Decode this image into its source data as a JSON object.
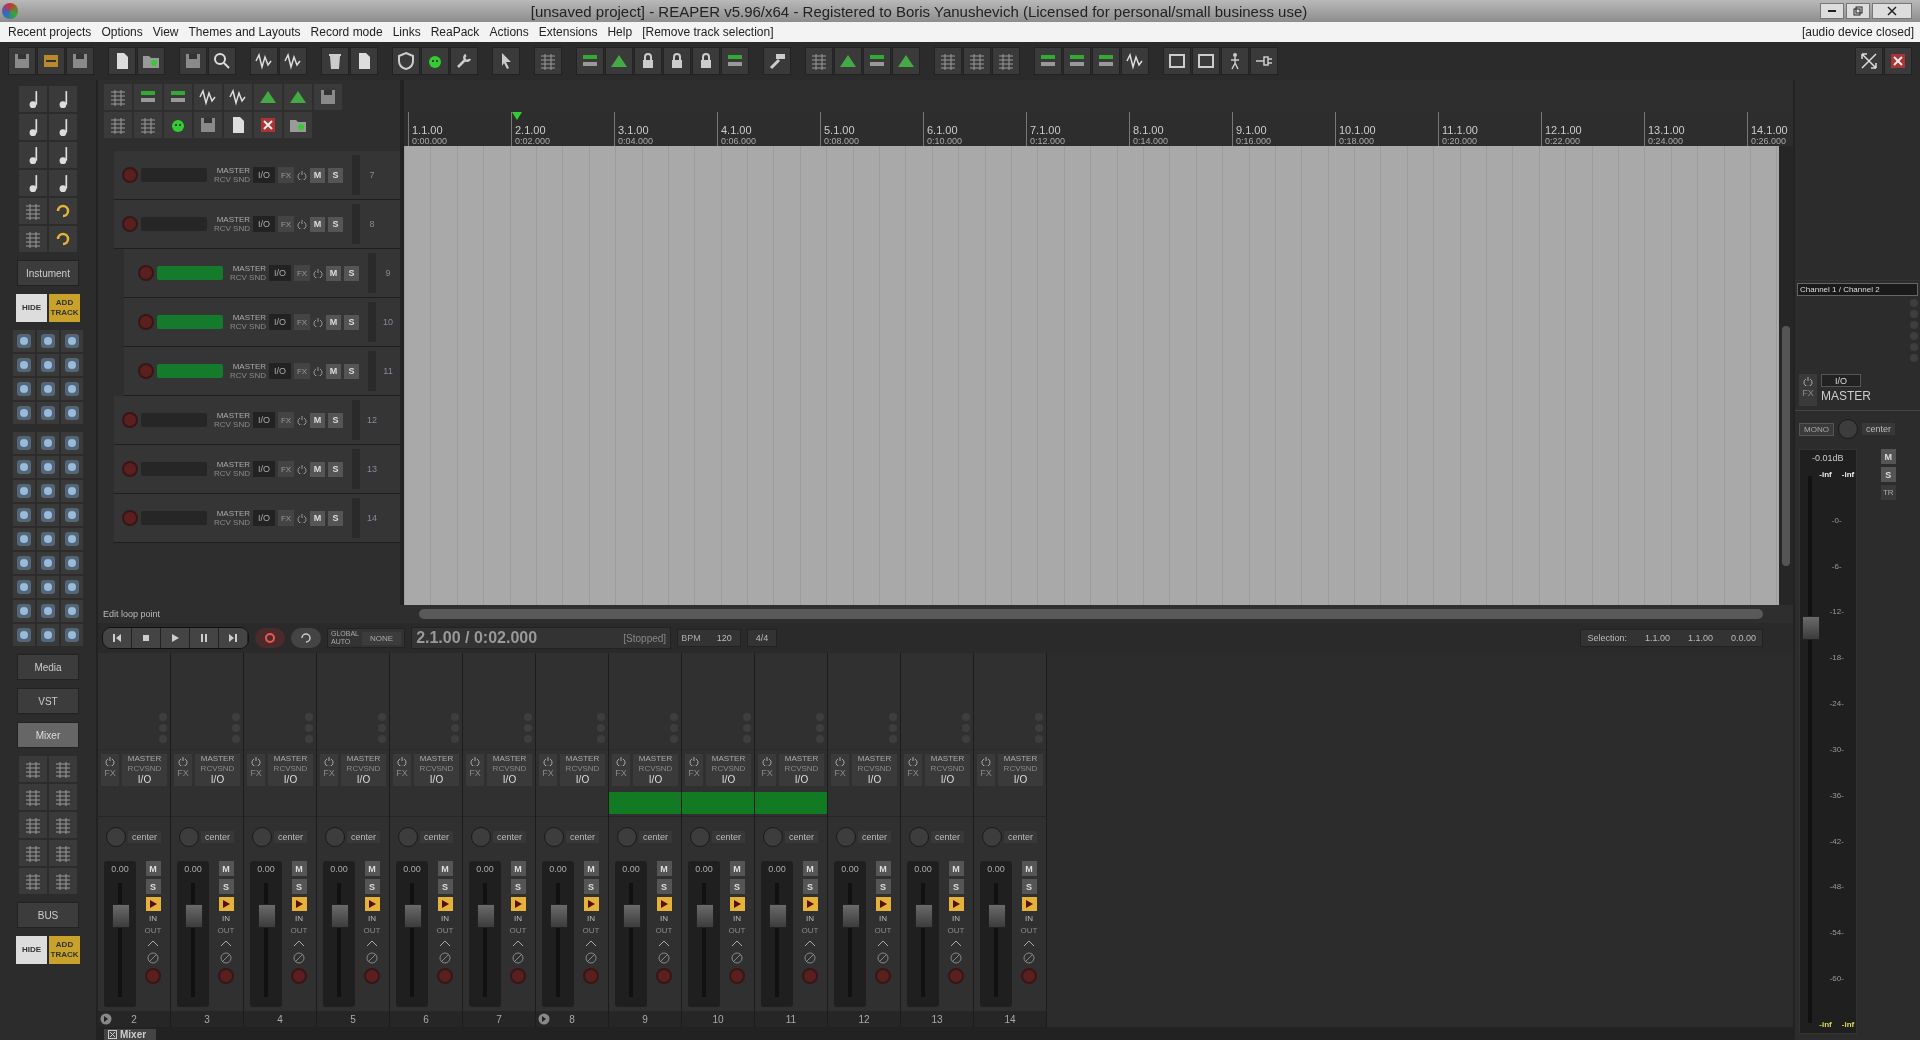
{
  "window": {
    "title": "[unsaved project] - REAPER v5.96/x64 - Registered to Boris Yanushevich (Licensed for personal/small business use)"
  },
  "menu": [
    "Recent projects",
    "Options",
    "View",
    "Themes and Layouts",
    "Record mode",
    "Links",
    "ReaPack",
    "Actions",
    "Extensions",
    "Help",
    "[Remove track selection]"
  ],
  "audio_status": "[audio device closed]",
  "left_panel": {
    "instrument_button": "Instument",
    "track_buttons_top": [
      "HIDE",
      "ADD TRACK"
    ],
    "view_buttons": [
      {
        "label": "Media",
        "selected": false
      },
      {
        "label": "VST",
        "selected": false
      },
      {
        "label": "Mixer",
        "selected": true
      }
    ],
    "bus_button": "BUS",
    "track_buttons_bottom": [
      "HIDE",
      "ADD TRACK"
    ]
  },
  "tracks": [
    {
      "number": "7",
      "selected": false,
      "send": "MASTER",
      "routing": "RCV SND",
      "io": "I/O",
      "fx": "FX",
      "mute": "M",
      "solo": "S"
    },
    {
      "number": "8",
      "selected": false,
      "send": "MASTER",
      "routing": "RCV SND",
      "io": "I/O",
      "fx": "FX",
      "mute": "M",
      "solo": "S",
      "children": [
        {
          "number": "9",
          "selected": true,
          "send": "MASTER",
          "routing": "RCV SND",
          "io": "I/O",
          "fx": "FX",
          "mute": "M",
          "solo": "S"
        },
        {
          "number": "10",
          "selected": true,
          "send": "MASTER",
          "routing": "RCV SND",
          "io": "I/O",
          "fx": "FX",
          "mute": "M",
          "solo": "S"
        },
        {
          "number": "11",
          "selected": true,
          "send": "MASTER",
          "routing": "RCV SND",
          "io": "I/O",
          "fx": "FX",
          "mute": "M",
          "solo": "S"
        }
      ]
    },
    {
      "number": "12",
      "selected": false,
      "send": "MASTER",
      "routing": "RCV SND",
      "io": "I/O",
      "fx": "FX",
      "mute": "M",
      "solo": "S"
    },
    {
      "number": "13",
      "selected": false,
      "send": "MASTER",
      "routing": "RCV SND",
      "io": "I/O",
      "fx": "FX",
      "mute": "M",
      "solo": "S"
    },
    {
      "number": "14",
      "selected": false,
      "send": "MASTER",
      "routing": "RCV SND",
      "io": "I/O",
      "fx": "FX",
      "mute": "M",
      "solo": "S"
    }
  ],
  "ruler": [
    {
      "bar": "1.1.00",
      "time": "0:00.000",
      "playhead": false
    },
    {
      "bar": "2.1.00",
      "time": "0:02.000",
      "playhead": true
    },
    {
      "bar": "3.1.00",
      "time": "0:04.000",
      "playhead": false
    },
    {
      "bar": "4.1.00",
      "time": "0:06.000",
      "playhead": false
    },
    {
      "bar": "5.1.00",
      "time": "0:08.000",
      "playhead": false
    },
    {
      "bar": "6.1.00",
      "time": "0:10.000",
      "playhead": false
    },
    {
      "bar": "7.1.00",
      "time": "0:12.000",
      "playhead": false
    },
    {
      "bar": "8.1.00",
      "time": "0:14.000",
      "playhead": false
    },
    {
      "bar": "9.1.00",
      "time": "0:16.000",
      "playhead": false
    },
    {
      "bar": "10.1.00",
      "time": "0:18.000",
      "playhead": false
    },
    {
      "bar": "11.1.00",
      "time": "0:20.000",
      "playhead": false
    },
    {
      "bar": "12.1.00",
      "time": "0:22.000",
      "playhead": false
    },
    {
      "bar": "13.1.00",
      "time": "0:24.000",
      "playhead": false
    },
    {
      "bar": "14.1.00",
      "time": "0:26.000",
      "playhead": false
    }
  ],
  "status_hint": "Edit loop point",
  "transport": {
    "auto_label": "GLOBAL AUTO",
    "auto_mode": "NONE",
    "position": "2.1.00 / 0:02.000",
    "state": "[Stopped]",
    "bpm_label": "BPM",
    "bpm": "120",
    "time_signature": "4/4",
    "selection_label": "Selection:",
    "selection": [
      "1.1.00",
      "1.1.00",
      "0.0.00"
    ]
  },
  "mixer_strips": [
    {
      "number": "2",
      "folder": true,
      "selected": false,
      "send": "MASTER",
      "routing": "RCVSND",
      "io": "I/O",
      "fx": "FX",
      "pan": "center",
      "volume": "0.00",
      "mute": "M",
      "solo": "S",
      "input": "IN",
      "output": "OUT",
      "level": 0.7
    },
    {
      "number": "3",
      "folder": false,
      "selected": false,
      "send": "MASTER",
      "routing": "RCVSND",
      "io": "I/O",
      "fx": "FX",
      "pan": "center",
      "volume": "0.00",
      "mute": "M",
      "solo": "S",
      "input": "IN",
      "output": "OUT",
      "level": 0.7
    },
    {
      "number": "4",
      "folder": false,
      "selected": false,
      "send": "MASTER",
      "routing": "RCVSND",
      "io": "I/O",
      "fx": "FX",
      "pan": "center",
      "volume": "0.00",
      "mute": "M",
      "solo": "S",
      "input": "IN",
      "output": "OUT",
      "level": 0.7
    },
    {
      "number": "5",
      "folder": false,
      "selected": false,
      "send": "MASTER",
      "routing": "RCVSND",
      "io": "I/O",
      "fx": "FX",
      "pan": "center",
      "volume": "0.00",
      "mute": "M",
      "solo": "S",
      "input": "IN",
      "output": "OUT",
      "level": 0.7
    },
    {
      "number": "6",
      "folder": false,
      "selected": false,
      "send": "MASTER",
      "routing": "RCVSND",
      "io": "I/O",
      "fx": "FX",
      "pan": "center",
      "volume": "0.00",
      "mute": "M",
      "solo": "S",
      "input": "IN",
      "output": "OUT",
      "level": 0.7
    },
    {
      "number": "7",
      "folder": false,
      "selected": false,
      "send": "MASTER",
      "routing": "RCVSND",
      "io": "I/O",
      "fx": "FX",
      "pan": "center",
      "volume": "0.00",
      "mute": "M",
      "solo": "S",
      "input": "IN",
      "output": "OUT",
      "level": 0.7
    },
    {
      "number": "8",
      "folder": true,
      "selected": false,
      "send": "MASTER",
      "routing": "RCVSND",
      "io": "I/O",
      "fx": "FX",
      "pan": "center",
      "volume": "0.00",
      "mute": "M",
      "solo": "S",
      "input": "IN",
      "output": "OUT",
      "level": 0.7
    },
    {
      "number": "9",
      "folder": false,
      "selected": true,
      "send": "MASTER",
      "routing": "RCVSND",
      "io": "I/O",
      "fx": "FX",
      "pan": "center",
      "volume": "0.00",
      "mute": "M",
      "solo": "S",
      "input": "IN",
      "output": "OUT",
      "level": 0.7
    },
    {
      "number": "10",
      "folder": false,
      "selected": true,
      "send": "MASTER",
      "routing": "RCVSND",
      "io": "I/O",
      "fx": "FX",
      "pan": "center",
      "volume": "0.00",
      "mute": "M",
      "solo": "S",
      "input": "IN",
      "output": "OUT",
      "level": 0.7
    },
    {
      "number": "11",
      "folder": false,
      "selected": true,
      "send": "MASTER",
      "routing": "RCVSND",
      "io": "I/O",
      "fx": "FX",
      "pan": "center",
      "volume": "0.00",
      "mute": "M",
      "solo": "S",
      "input": "IN",
      "output": "OUT",
      "level": 0.7
    },
    {
      "number": "12",
      "folder": false,
      "selected": false,
      "send": "MASTER",
      "routing": "RCVSND",
      "io": "I/O",
      "fx": "FX",
      "pan": "center",
      "volume": "0.00",
      "mute": "M",
      "solo": "S",
      "input": "IN",
      "output": "OUT",
      "level": 0.7
    },
    {
      "number": "13",
      "folder": false,
      "selected": false,
      "send": "MASTER",
      "routing": "RCVSND",
      "io": "I/O",
      "fx": "FX",
      "pan": "center",
      "volume": "0.00",
      "mute": "M",
      "solo": "S",
      "input": "IN",
      "output": "OUT",
      "level": 0.7
    },
    {
      "number": "14",
      "folder": false,
      "selected": false,
      "send": "MASTER",
      "routing": "RCVSND",
      "io": "I/O",
      "fx": "FX",
      "pan": "center",
      "volume": "0.00",
      "mute": "M",
      "solo": "S",
      "input": "IN",
      "output": "OUT",
      "level": 0.7
    }
  ],
  "mixer_tab": "Mixer",
  "master": {
    "channels": "Channel 1 / Channel 2",
    "io": "I/O",
    "fx": "FX",
    "name": "MASTER",
    "mono": "MONO",
    "pan": "center",
    "volume": "-0.01dB",
    "mute": "M",
    "solo": "S",
    "trim": "TR",
    "peaks_top": [
      "-inf",
      "-inf"
    ],
    "peaks_bottom": [
      "-inf",
      "-inf"
    ],
    "scale": [
      "-0-",
      "-6-",
      "-12-",
      "-18-",
      "-24-",
      "-30-",
      "-36-",
      "-42-",
      "-48-",
      "-54-",
      "-60-"
    ],
    "level": 0.72
  }
}
